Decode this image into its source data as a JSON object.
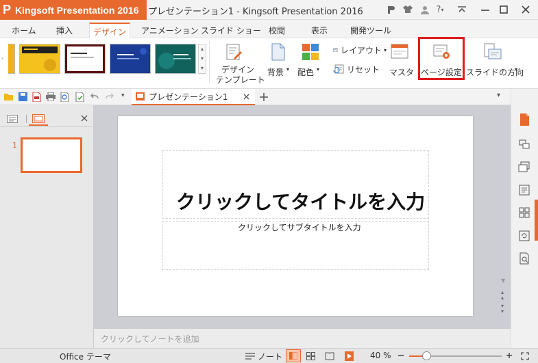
{
  "app": {
    "logo": "P",
    "name": "Kingsoft Presentation 2016",
    "caret": "▼",
    "window_title": "プレゼンテーション1 - Kingsoft Presentation 2016"
  },
  "titlebar": {
    "help": "?"
  },
  "tabs": [
    {
      "label": "ホーム"
    },
    {
      "label": "挿入"
    },
    {
      "label": "デザイン"
    },
    {
      "label": "アニメーション"
    },
    {
      "label": "スライド ショー"
    },
    {
      "label": "校閲"
    },
    {
      "label": "表示"
    },
    {
      "label": "開発ツール"
    }
  ],
  "ribbon": {
    "design_template": {
      "line1": "デザイン",
      "line2": "テンプレート"
    },
    "background": "背景",
    "color": "配色",
    "layout": "レイアウト",
    "reset": "リセット",
    "master": "マスタ",
    "page_setup": "ページ設定",
    "slide_direction": "スライドの方向"
  },
  "document": {
    "tab_label": "プレゼンテーション1"
  },
  "slides_pane": {
    "slide_number": "1"
  },
  "slide": {
    "title_placeholder": "クリックしてタイトルを入力",
    "subtitle_placeholder": "クリックしてサブタイトルを入力"
  },
  "notes": {
    "placeholder": "クリックしてノートを追加"
  },
  "status": {
    "theme": "Office テーマ",
    "notes_label": "ノート",
    "zoom": "40 %"
  },
  "colors": {
    "accent": "#e8692d",
    "highlight": "#e01c1c"
  }
}
